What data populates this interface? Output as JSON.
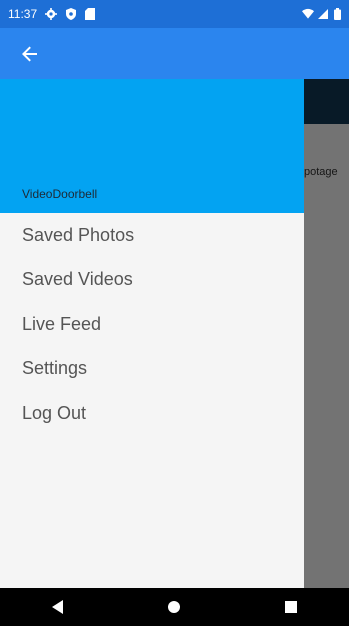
{
  "status_bar": {
    "time": "11:37",
    "icons_left": [
      "settings-gear-icon",
      "shield-icon",
      "sd-card-icon"
    ],
    "icons_right": [
      "wifi-icon",
      "cell-signal-icon",
      "battery-icon"
    ]
  },
  "app_bar": {
    "back_icon": "back-arrow-icon"
  },
  "drawer": {
    "header_title": "VideoDoorbell",
    "menu_items": [
      "Saved Photos",
      "Saved Videos",
      "Live Feed",
      "Settings",
      "Log Out"
    ]
  },
  "background_content": {
    "partial_text": "potage"
  },
  "nav_bar": {
    "buttons": [
      "back-triangle-icon",
      "home-circle-icon",
      "recents-square-icon"
    ]
  },
  "colors": {
    "status_bar": "#1e6fd6",
    "app_bar": "#2b85ee",
    "drawer_header": "#03a3f2",
    "drawer_bg": "#f5f5f5",
    "nav_bar": "#000000"
  }
}
